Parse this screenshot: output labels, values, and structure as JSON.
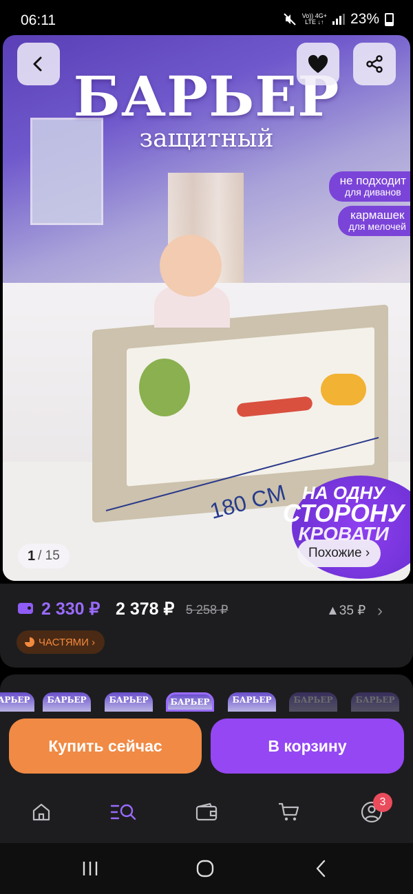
{
  "status_bar": {
    "time": "06:11",
    "net_top": "Vo)) 4G+",
    "net_bottom": "LTE ↓↑",
    "battery": "23%"
  },
  "hero": {
    "title": "БАРЬЕР",
    "subtitle": "защитный",
    "pill_1": {
      "line1": "не подходит",
      "line2": "для диванов"
    },
    "pill_2": {
      "line1": "кармашек",
      "line2": "для мелочей"
    },
    "dimension": "180 CM",
    "promo": {
      "line1": "НА ОДНУ",
      "line2": "СТОРОНУ",
      "line3": "КРОВАТИ"
    },
    "counter_current": "1",
    "counter_total": "/ 15",
    "similar_label": "Похожие ›",
    "icons": {
      "back": "back-arrow-icon",
      "favorite": "heart-icon",
      "share": "share-icon"
    }
  },
  "price": {
    "wallet_price": "2 330 ₽",
    "price": "2 378 ₽",
    "old_price": "5 258 ₽",
    "change": "▲35 ₽",
    "installments_label": "ЧАСТЯМИ ›",
    "accent": "#9a6bff"
  },
  "thumbnails": [
    "БАРЬЕР",
    "БАРЬЕР",
    "БАРЬЕР",
    "БАРЬЕР",
    "БАРЬЕР",
    "БАРЬЕР",
    "БАРЬЕР"
  ],
  "actions": {
    "buy_now": "Купить сейчас",
    "add_to_cart": "В корзину",
    "buy_color": "#f08a45",
    "cart_color": "#9447f2"
  },
  "bottom_nav": {
    "items": [
      "home-icon",
      "catalog-search-icon",
      "wallet-icon",
      "cart-icon",
      "profile-icon"
    ],
    "profile_badge": "3"
  }
}
